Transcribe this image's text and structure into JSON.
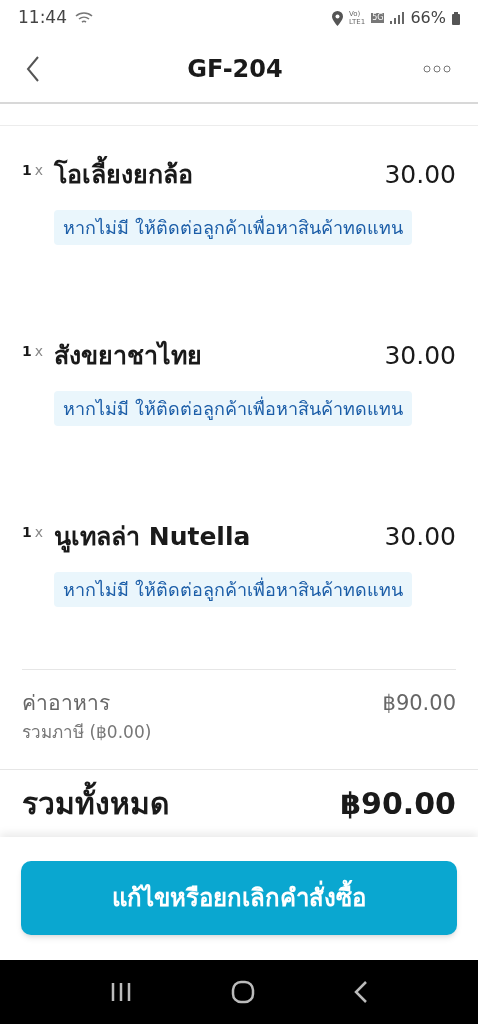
{
  "status_bar": {
    "time": "11:44",
    "network_labels": [
      "Vo)",
      "LTE1"
    ],
    "network_type": "5G",
    "battery": "66%"
  },
  "header": {
    "title": "GF-204"
  },
  "items": [
    {
      "qty": "1",
      "qty_mark": "x",
      "name": "โอเลี้ยงยกล้อ",
      "price": "30.00",
      "note": "หากไม่มี ให้ติดต่อลูกค้าเพื่อหาสินค้าทดแทน"
    },
    {
      "qty": "1",
      "qty_mark": "x",
      "name": "สังขยาชาไทย",
      "price": "30.00",
      "note": "หากไม่มี ให้ติดต่อลูกค้าเพื่อหาสินค้าทดแทน"
    },
    {
      "qty": "1",
      "qty_mark": "x",
      "name": "นูเทลล่า Nutella",
      "price": "30.00",
      "note": "หากไม่มี ให้ติดต่อลูกค้าเพื่อหาสินค้าทดแทน"
    }
  ],
  "fees": {
    "label": "ค่าอาหาร",
    "tax": "รวมภาษี (฿0.00)",
    "amount": "฿90.00"
  },
  "total": {
    "label": "รวมทั้งหมด",
    "amount": "฿90.00"
  },
  "action_button": "แก้ไขหรือยกเลิกคำสั่งซื้อ"
}
